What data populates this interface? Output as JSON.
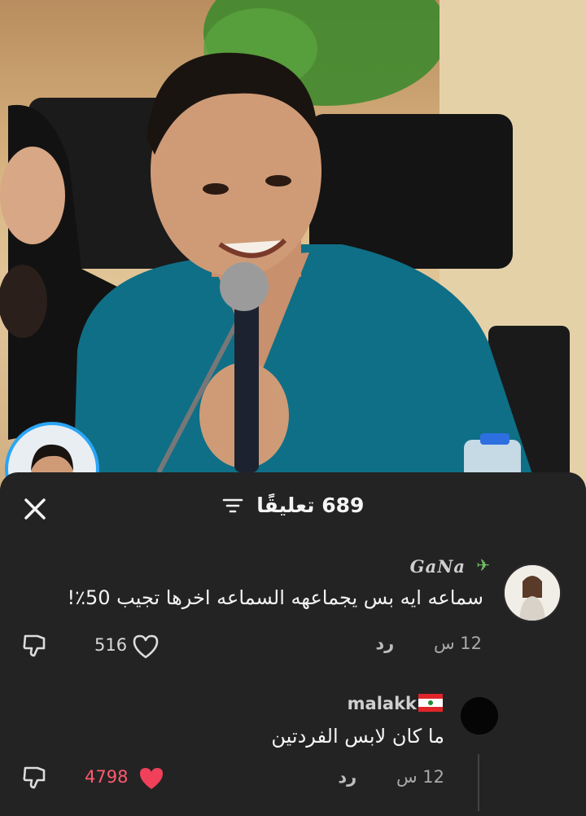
{
  "photo": {
    "description_hidden": true
  },
  "comments_header": {
    "title": "689 تعليقًا",
    "close_icon": "close-icon",
    "filter_icon": "filter-icon"
  },
  "comments": [
    {
      "username": "GaNa",
      "text": "سماعه ايه بس يجماعهه السماعه اخرها تجيب 50٪!",
      "time": "12 س",
      "reply_label": "رد",
      "likes": "516",
      "liked": false
    },
    {
      "username": "malakk",
      "text": "ما كان لابس الفردتين",
      "time": "12 س",
      "reply_label": "رد",
      "likes": "4798",
      "liked": true
    }
  ],
  "colors": {
    "sheet": "#232324",
    "like_active": "#f0405a",
    "like_count_active": "#ff5a6e"
  }
}
